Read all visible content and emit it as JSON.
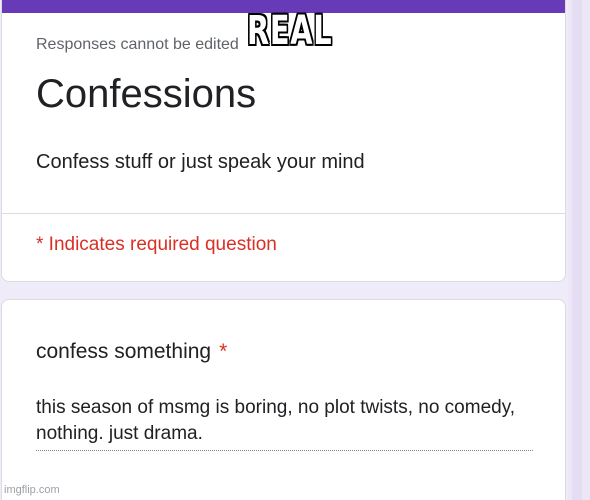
{
  "form": {
    "notice": "Responses cannot be edited",
    "title": "Confessions",
    "description": "Confess stuff or just speak your mind",
    "required_note": "* Indicates required question"
  },
  "question": {
    "label": "confess something",
    "required_mark": "*",
    "answer": "this season of msmg is boring, no plot twists, no comedy, nothing. just drama."
  },
  "meme": {
    "caption": "REAL",
    "watermark": "imgflip.com"
  },
  "colors": {
    "accent": "#673ab7",
    "required": "#d93025",
    "background": "#f0ebf8"
  }
}
